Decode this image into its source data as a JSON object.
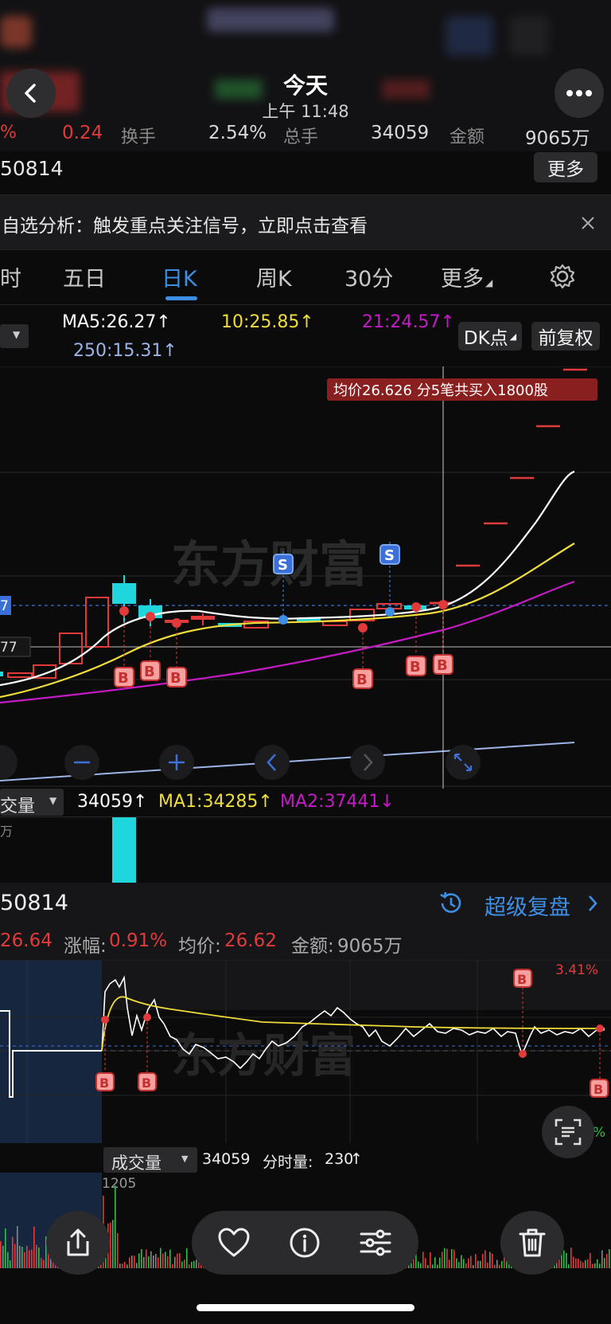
{
  "header": {
    "title": "今天",
    "time": "上午 11:48"
  },
  "quote_strip": {
    "change": "0.24",
    "turnover_label": "换手",
    "turnover_value": "2.54%",
    "hands_label": "总手",
    "hands_value": "34059",
    "amount_label": "金额",
    "amount_value": "9065万",
    "code_fragment": "50814",
    "more_button": "更多"
  },
  "notice": {
    "text": "自选分析：触发重点关注信号，立即点击查看"
  },
  "tabs": [
    "时",
    "五日",
    "日K",
    "周K",
    "30分",
    "更多"
  ],
  "active_tab": "日K",
  "ma": {
    "ma5": "MA5:26.27↑",
    "ma10": "10:25.85↑",
    "ma21": "21:24.57↑",
    "ma250": "250:15.31↑",
    "dk_button": "DK点",
    "fq_button": "前复权"
  },
  "kline": {
    "tooltip": "均价26.626 分5笔共买入1800股",
    "left_price_1": "7",
    "left_price_2": "77",
    "marker_b": "B",
    "marker_s": "S"
  },
  "volume": {
    "selector": "交量",
    "value": "34059↑",
    "ma1": "MA1:34285↑",
    "ma2": "MA2:37441↓",
    "unit": "万"
  },
  "replay": {
    "code": "50814",
    "super_replay": "超级复盘"
  },
  "intraday": {
    "price": "26.64",
    "change_label": "涨幅:",
    "change_value": "0.91%",
    "avg_label": "均价:",
    "avg_value": "26.62",
    "amount_label": "金额:",
    "amount_value": "9065万",
    "top_pct": "3.41%",
    "right_pct": "%"
  },
  "intraday_volume": {
    "selector": "成交量",
    "value": "34059",
    "minute_label": "分时量:",
    "minute_value": "230",
    "minute_arrow": "↑",
    "axis_value": "1205"
  },
  "colors": {
    "up": "#e03a3a",
    "down": "#1fd6dc",
    "ma5": "#ffffff",
    "ma10": "#f0dd3a",
    "ma21": "#c41bc4",
    "ma250": "#9db4e6",
    "accent": "#3d8fe6"
  }
}
